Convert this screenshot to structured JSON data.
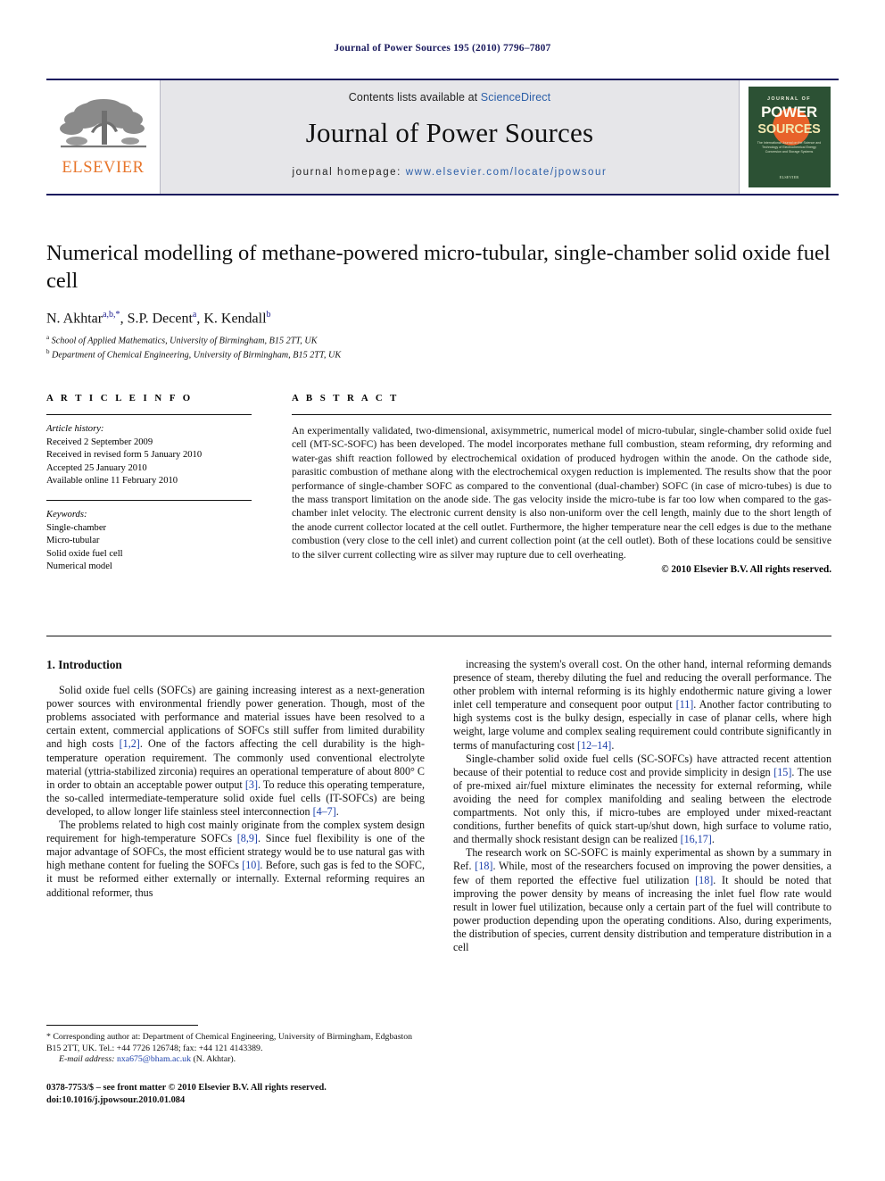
{
  "running_head": "Journal of Power Sources 195 (2010) 7796–7807",
  "masthead": {
    "contents_prefix": "Contents lists available at ",
    "sciencedirect": "ScienceDirect",
    "journal_title": "Journal of Power Sources",
    "homepage_label": "journal homepage: ",
    "homepage_url": "www.elsevier.com/locate/jpowsour",
    "publisher_name": "ELSEVIER",
    "cover": {
      "journal_of": "JOURNAL OF",
      "power": "POWER",
      "sources": "SOURCES",
      "subtitle": "The International Journal on the Science and Technology of Electrochemical Energy Conversion and Storage Systems",
      "publisher": "ELSEVIER"
    },
    "accent_blue": "#2c5fa8",
    "rule_navy": "#1b1b5e",
    "elsevier_orange": "#e8762c",
    "cover_green": "#2c5134",
    "cover_sun_orange": "#e8622a"
  },
  "article": {
    "title": "Numerical modelling of methane-powered micro-tubular, single-chamber solid oxide fuel cell",
    "authors_html": "N. Akhtar<sup>a,b,*</sup>, S.P. Decent<sup>a</sup>, K. Kendall<sup>b</sup>",
    "affiliations": [
      {
        "marker": "a",
        "text": "School of Applied Mathematics, University of Birmingham, B15 2TT, UK"
      },
      {
        "marker": "b",
        "text": "Department of Chemical Engineering, University of Birmingham, B15 2TT, UK"
      }
    ]
  },
  "article_info": {
    "heading": "A R T I C L E   I N F O",
    "history_label": "Article history:",
    "history": [
      "Received 2 September 2009",
      "Received in revised form 5 January 2010",
      "Accepted 25 January 2010",
      "Available online 11 February 2010"
    ],
    "keywords_label": "Keywords:",
    "keywords": [
      "Single-chamber",
      "Micro-tubular",
      "Solid oxide fuel cell",
      "Numerical model"
    ]
  },
  "abstract": {
    "heading": "A B S T R A C T",
    "body": "An experimentally validated, two-dimensional, axisymmetric, numerical model of micro-tubular, single-chamber solid oxide fuel cell (MT-SC-SOFC) has been developed. The model incorporates methane full combustion, steam reforming, dry reforming and water-gas shift reaction followed by electrochemical oxidation of produced hydrogen within the anode. On the cathode side, parasitic combustion of methane along with the electrochemical oxygen reduction is implemented. The results show that the poor performance of single-chamber SOFC as compared to the conventional (dual-chamber) SOFC (in case of micro-tubes) is due to the mass transport limitation on the anode side. The gas velocity inside the micro-tube is far too low when compared to the gas-chamber inlet velocity. The electronic current density is also non-uniform over the cell length, mainly due to the short length of the anode current collector located at the cell outlet. Furthermore, the higher temperature near the cell edges is due to the methane combustion (very close to the cell inlet) and current collection point (at the cell outlet). Both of these locations could be sensitive to the silver current collecting wire as silver may rupture due to cell overheating.",
    "copyright": "© 2010 Elsevier B.V. All rights reserved."
  },
  "body": {
    "section_heading": "1. Introduction",
    "left_paragraphs_html": [
      "Solid oxide fuel cells (SOFCs) are gaining increasing interest as a next-generation power sources with environmental friendly power generation. Though, most of the problems associated with performance and material issues have been resolved to a certain extent, commercial applications of SOFCs still suffer from limited durability and high costs <span class=\"ref\">[1,2]</span>. One of the factors affecting the cell durability is the high-temperature operation requirement. The commonly used conventional electrolyte material (yttria-stabilized zirconia) requires an operational temperature of about 800° C in order to obtain an acceptable power output <span class=\"ref\">[3]</span>. To reduce this operating temperature, the so-called intermediate-temperature solid oxide fuel cells (IT-SOFCs) are being developed, to allow longer life stainless steel interconnection <span class=\"ref\">[4–7]</span>.",
      "The problems related to high cost mainly originate from the complex system design requirement for high-temperature SOFCs <span class=\"ref\">[8,9]</span>. Since fuel flexibility is one of the major advantage of SOFCs, the most efficient strategy would be to use natural gas with high methane content for fueling the SOFCs <span class=\"ref\">[10]</span>. Before, such gas is fed to the SOFC, it must be reformed either externally or internally. External reforming requires an additional reformer, thus"
    ],
    "right_paragraphs_html": [
      "increasing the system's overall cost. On the other hand, internal reforming demands presence of steam, thereby diluting the fuel and reducing the overall performance. The other problem with internal reforming is its highly endothermic nature giving a lower inlet cell temperature and consequent poor output <span class=\"ref\">[11]</span>. Another factor contributing to high systems cost is the bulky design, especially in case of planar cells, where high weight, large volume and complex sealing requirement could contribute significantly in terms of manufacturing cost <span class=\"ref\">[12–14]</span>.",
      "Single-chamber solid oxide fuel cells (SC-SOFCs) have attracted recent attention because of their potential to reduce cost and provide simplicity in design <span class=\"ref\">[15]</span>. The use of pre-mixed air/fuel mixture eliminates the necessity for external reforming, while avoiding the need for complex manifolding and sealing between the electrode compartments. Not only this, if micro-tubes are employed under mixed-reactant conditions, further benefits of quick start-up/shut down, high surface to volume ratio, and thermally shock resistant design can be realized <span class=\"ref\">[16,17]</span>.",
      "The research work on SC-SOFC is mainly experimental as shown by a summary in Ref. <span class=\"ref\">[18]</span>. While, most of the researchers focused on improving the power densities, a few of them reported the effective fuel utilization <span class=\"ref\">[18]</span>. It should be noted that improving the power density by means of increasing the inlet fuel flow rate would result in lower fuel utilization, because only a certain part of the fuel will contribute to power production depending upon the operating conditions. Also, during experiments, the distribution of species, current density distribution and temperature distribution in a cell"
    ]
  },
  "footnote": {
    "corresponding_html": "* Corresponding author at: Department of Chemical Engineering, University of Birmingham, Edgbaston B15 2TT, UK. Tel.: +44 7726 126748; fax: +44 121 4143389.",
    "email_label": "E-mail address:",
    "email": "nxa675@bham.ac.uk",
    "email_suffix": "(N. Akhtar)."
  },
  "colophon": {
    "issn_line": "0378-7753/$ – see front matter © 2010 Elsevier B.V. All rights reserved.",
    "doi_line": "doi:10.1016/j.jpowsour.2010.01.084"
  }
}
